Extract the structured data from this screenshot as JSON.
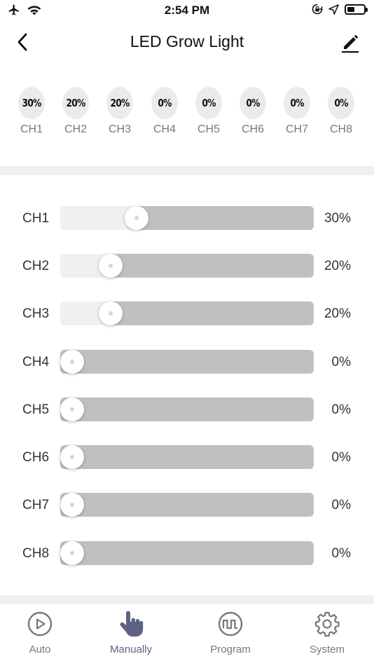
{
  "status_bar": {
    "time": "2:54 PM",
    "battery_level": 0.45
  },
  "header": {
    "title": "LED Grow Light"
  },
  "summary": [
    {
      "value": "30%",
      "label": "CH1"
    },
    {
      "value": "20%",
      "label": "CH2"
    },
    {
      "value": "20%",
      "label": "CH3"
    },
    {
      "value": "0%",
      "label": "CH4"
    },
    {
      "value": "0%",
      "label": "CH5"
    },
    {
      "value": "0%",
      "label": "CH6"
    },
    {
      "value": "0%",
      "label": "CH7"
    },
    {
      "value": "0%",
      "label": "CH8"
    }
  ],
  "sliders": [
    {
      "label": "CH1",
      "value_text": "30%",
      "level": 0.3
    },
    {
      "label": "CH2",
      "value_text": "20%",
      "level": 0.2
    },
    {
      "label": "CH3",
      "value_text": "20%",
      "level": 0.2
    },
    {
      "label": "CH4",
      "value_text": "0%",
      "level": 0.0
    },
    {
      "label": "CH5",
      "value_text": "0%",
      "level": 0.0
    },
    {
      "label": "CH6",
      "value_text": "0%",
      "level": 0.0
    },
    {
      "label": "CH7",
      "value_text": "0%",
      "level": 0.0
    },
    {
      "label": "CH8",
      "value_text": "0%",
      "level": 0.0
    }
  ],
  "tabs": [
    {
      "label": "Auto",
      "icon": "play-circle-icon"
    },
    {
      "label": "Manually",
      "icon": "hand-pointer-icon",
      "active": true
    },
    {
      "label": "Program",
      "icon": "waveform-circle-icon"
    },
    {
      "label": "System",
      "icon": "gear-icon"
    }
  ],
  "colors": {
    "active_tab": "#5e6282",
    "inactive_tab": "#777777",
    "track": "#c0c0c0",
    "track_fill": "#f0f0f0",
    "divider": "#f0f0f3"
  }
}
